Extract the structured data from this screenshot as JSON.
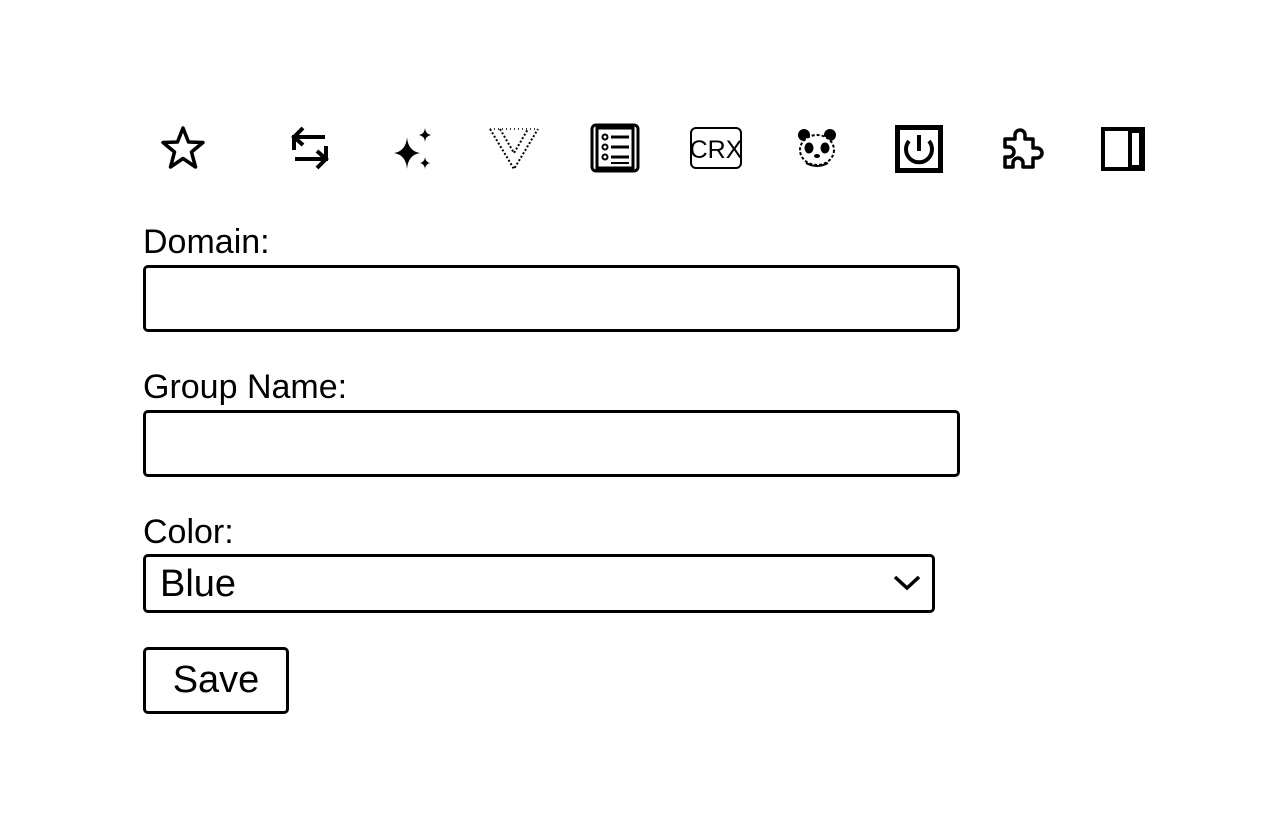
{
  "toolbar": {
    "icons": [
      {
        "name": "bookmark-star-icon"
      },
      {
        "name": "tab-sync-icon"
      },
      {
        "name": "sparkle-ai-icon"
      },
      {
        "name": "vue-devtools-icon"
      },
      {
        "name": "list-notes-icon"
      },
      {
        "name": "crx-extension-icon",
        "label": "CRX"
      },
      {
        "name": "panda-icon"
      },
      {
        "name": "power-extension-icon"
      },
      {
        "name": "extensions-puzzle-icon"
      },
      {
        "name": "side-panel-icon"
      }
    ]
  },
  "form": {
    "domain_label": "Domain:",
    "domain_value": "",
    "group_name_label": "Group Name:",
    "group_name_value": "",
    "color_label": "Color:",
    "color_selected": "Blue",
    "save_label": "Save"
  }
}
